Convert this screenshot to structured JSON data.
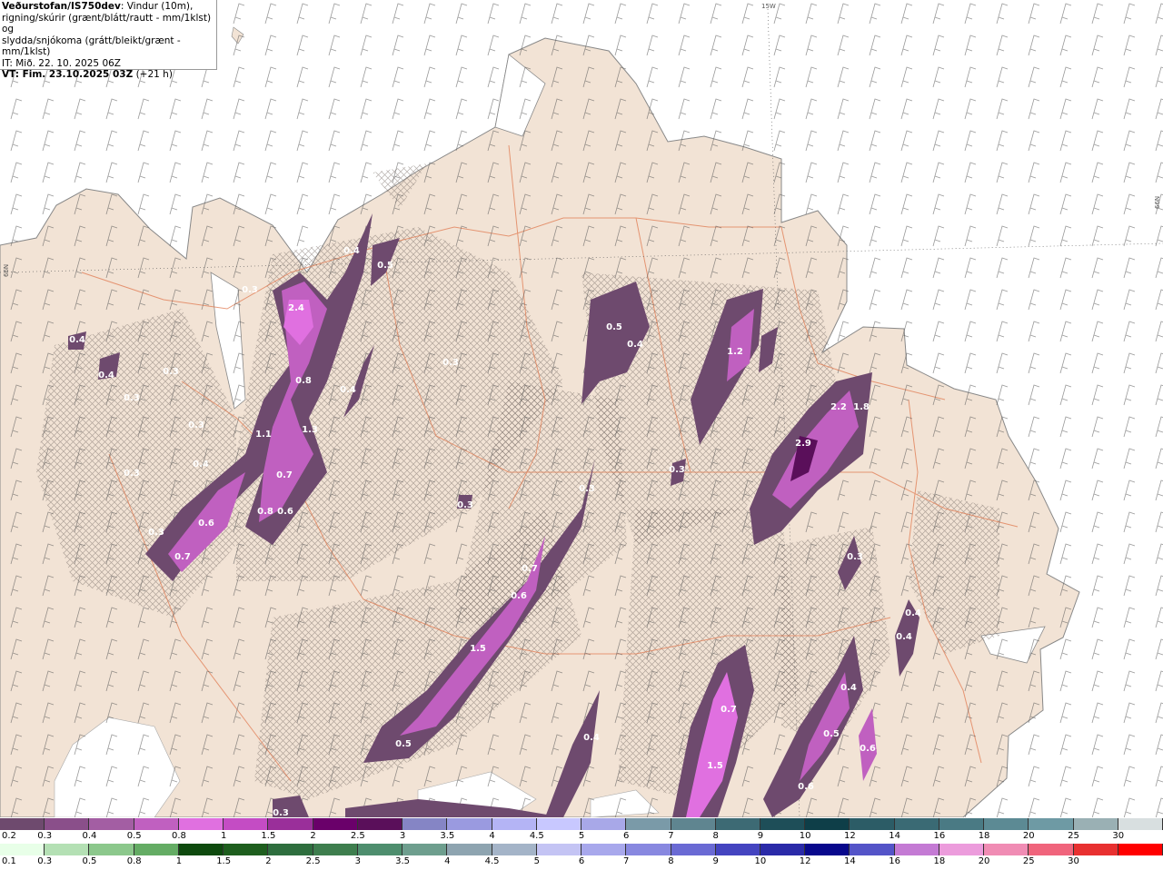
{
  "info": {
    "source": "Veðurstofan/IS750dev",
    "desc_line1": ": Vindur (10m),",
    "desc_line2": "rigning/skúrir (grænt/blátt/rautt - mm/1klst) og",
    "desc_line3": "slydda/snjókoma (grátt/bleikt/grænt - mm/1klst)",
    "it_line": "IT: Mið. 22. 10. 2025 06Z",
    "vt_prefix": "VT: Fim. 23.10.2025 03Z",
    "vt_suffix": " (+21 h)"
  },
  "graticule": {
    "lon_label": "15W",
    "lat_label_left": "66N",
    "lat_label_right": "66N"
  },
  "map_values": [
    {
      "v": "2.4"
    },
    {
      "v": "0.3"
    },
    {
      "v": "0.4"
    },
    {
      "v": "0.5"
    },
    {
      "v": "0.8"
    },
    {
      "v": "0.4"
    },
    {
      "v": "1.3"
    },
    {
      "v": "1.1"
    },
    {
      "v": "0.7"
    },
    {
      "v": "0.8"
    },
    {
      "v": "0.6"
    },
    {
      "v": "0.6"
    },
    {
      "v": "0.7"
    },
    {
      "v": "0.3"
    },
    {
      "v": "0.4"
    },
    {
      "v": "0.4"
    },
    {
      "v": "0.3"
    },
    {
      "v": "0.3"
    },
    {
      "v": "0.3"
    },
    {
      "v": "0.4"
    },
    {
      "v": "0.3"
    },
    {
      "v": "0.5"
    },
    {
      "v": "0.4"
    },
    {
      "v": "1.2"
    },
    {
      "v": "0.3"
    },
    {
      "v": "0.3"
    },
    {
      "v": "0.3"
    },
    {
      "v": "0.7"
    },
    {
      "v": "0.6"
    },
    {
      "v": "1.5"
    },
    {
      "v": "0.5"
    },
    {
      "v": "2.2"
    },
    {
      "v": "1.8"
    },
    {
      "v": "2.9"
    },
    {
      "v": "0.3"
    },
    {
      "v": "0.4"
    },
    {
      "v": "0.4"
    },
    {
      "v": "0.4"
    },
    {
      "v": "0.4"
    },
    {
      "v": "0.7"
    },
    {
      "v": "1.5"
    },
    {
      "v": "0.5"
    },
    {
      "v": "0.6"
    },
    {
      "v": "0.6"
    },
    {
      "v": "0.3"
    },
    {
      "v": "0.3"
    }
  ],
  "colorbar_top": {
    "labels": [
      "0.2",
      "0.3",
      "0.4",
      "0.5",
      "0.8",
      "1",
      "1.5",
      "2",
      "2.5",
      "3",
      "3.5",
      "4",
      "4.5",
      "5",
      "6",
      "7",
      "8",
      "9",
      "10",
      "12",
      "14",
      "16",
      "18",
      "20",
      "25",
      "30"
    ],
    "colors": [
      "#6e4a6e",
      "#8a4f8a",
      "#a35ea3",
      "#c060c0",
      "#e070e0",
      "#c44cc4",
      "#9a2f9a",
      "#6a006a",
      "#5a0f5a",
      "#8585c5",
      "#9a9ae0",
      "#b4b4f5",
      "#c8c8ff",
      "#a8a8e8",
      "#7a9aa8",
      "#5f8590",
      "#3d6a74",
      "#1e4e58",
      "#0e3e48",
      "#2c5c66",
      "#3a6a74",
      "#4a7a84",
      "#5c8a94",
      "#6e9aa4",
      "#9ab0b4",
      "#d8dfe0"
    ]
  },
  "colorbar_bottom": {
    "labels": [
      "0.1",
      "0.3",
      "0.5",
      "0.8",
      "1",
      "1.5",
      "2",
      "2.5",
      "3",
      "3.5",
      "4",
      "4.5",
      "5",
      "6",
      "7",
      "8",
      "9",
      "10",
      "12",
      "14",
      "16",
      "18",
      "20",
      "25",
      "30"
    ],
    "colors": [
      "#e8ffe8",
      "#b4e0b4",
      "#8cc88c",
      "#64ac64",
      "#0e4a0e",
      "#1e5e1e",
      "#2e6e3e",
      "#3e7e4e",
      "#4e8e6e",
      "#6e9e8e",
      "#8ea4b0",
      "#a4b4c8",
      "#c4c4f4",
      "#a8a8ec",
      "#8888e0",
      "#6a6ad4",
      "#4444c0",
      "#2a2aa8",
      "#08088c",
      "#5454c8",
      "#c47ad4",
      "#ec9cdc",
      "#f08cb4",
      "#f0647c",
      "#e83030",
      "#ff0000"
    ]
  }
}
